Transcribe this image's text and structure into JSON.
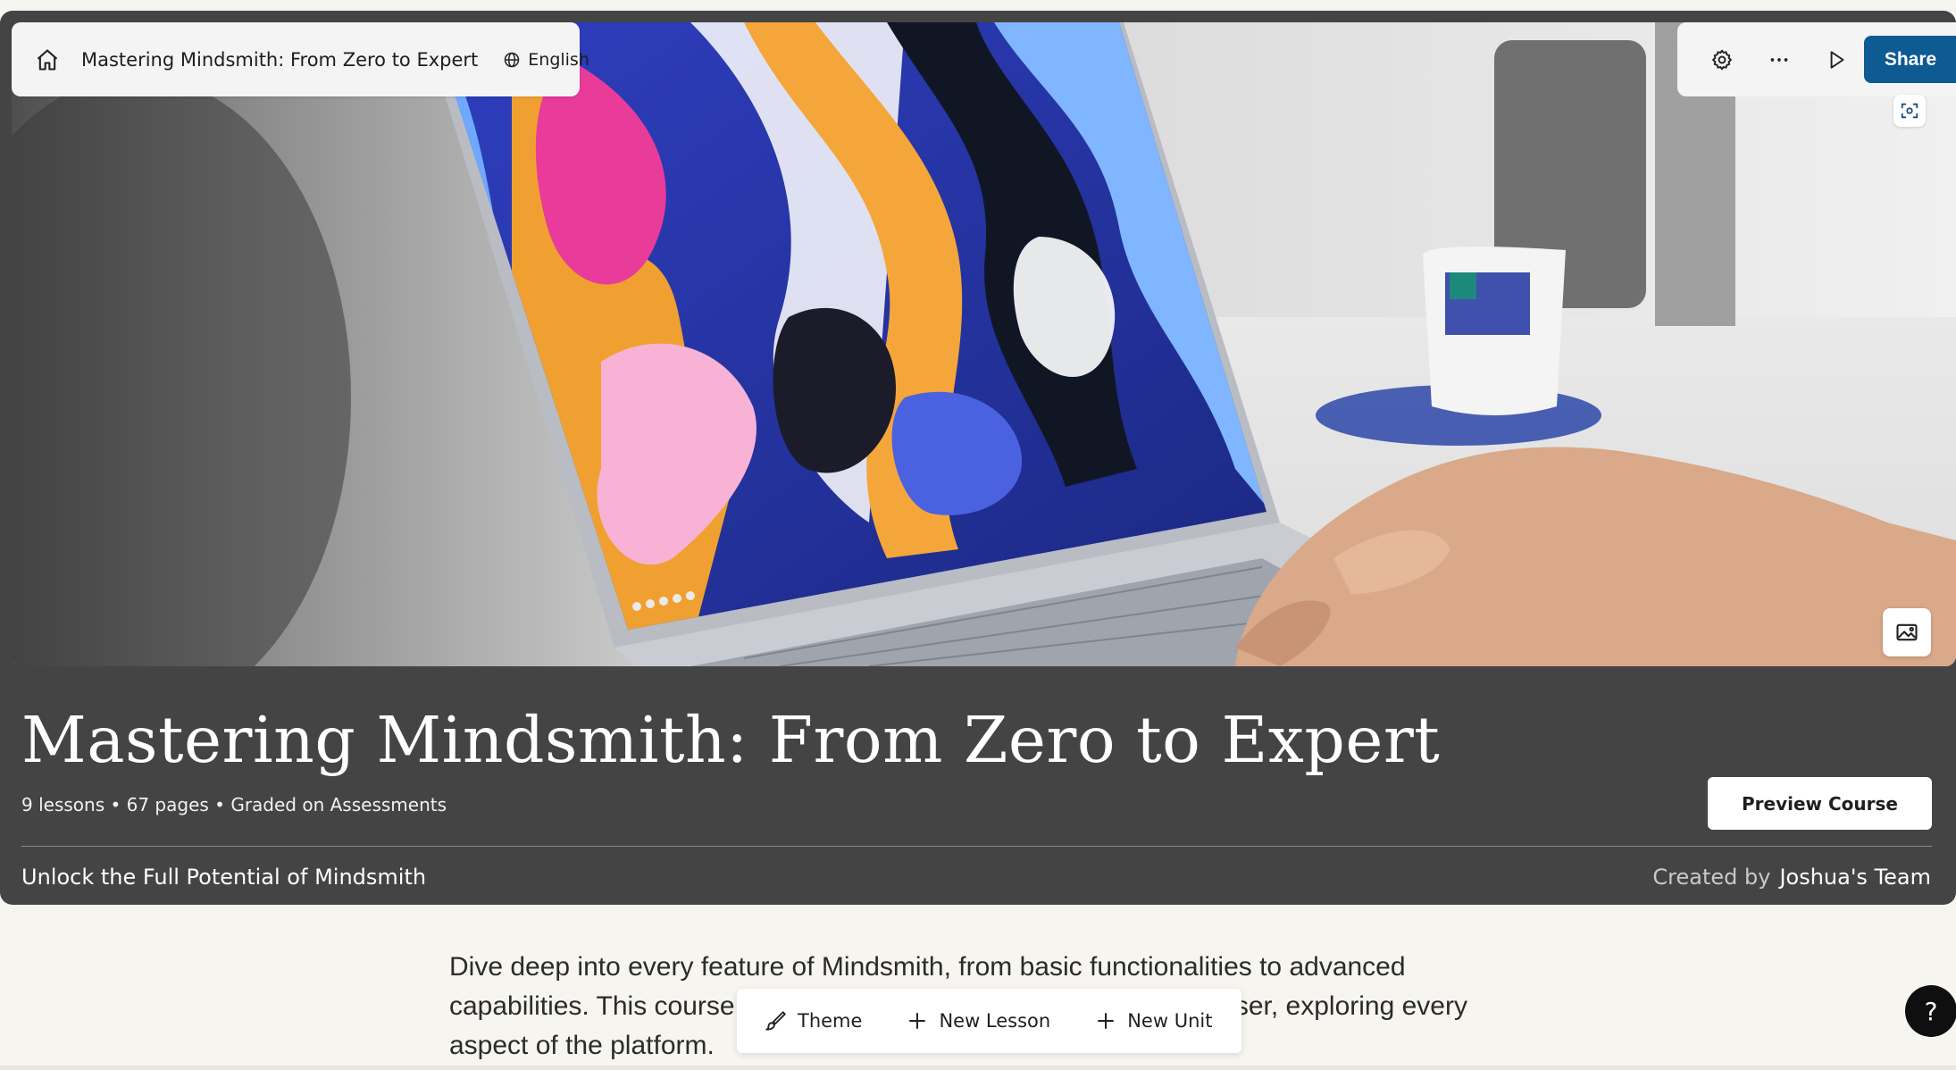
{
  "header": {
    "course_title": "Mastering Mindsmith: From Zero to Expert",
    "language": "English",
    "icons": {
      "home": "home-icon",
      "globe": "globe-icon",
      "settings": "gear-icon",
      "more": "more-horizontal-icon",
      "play": "play-icon"
    },
    "share_label": "Share"
  },
  "hero": {
    "title": "Mastering Mindsmith: From Zero to Expert",
    "meta": "9 lessons • 67 pages • Graded on Assessments",
    "preview_label": "Preview Course",
    "subtitle": "Unlock the Full Potential of Mindsmith",
    "created_by_label": "Created by",
    "team_name": "Joshua's Team"
  },
  "description": "Dive deep into every feature of Mindsmith, from basic functionalities to advanced capabilities. This course will guide you from a novice to a master user, exploring every aspect of the platform.",
  "toolbar": {
    "theme_label": "Theme",
    "new_lesson_label": "New Lesson",
    "new_unit_label": "New Unit"
  },
  "help_label": "?",
  "colors": {
    "accent": "#0e5a92",
    "hero_bg": "#444444",
    "page_bg": "#f7f5f0"
  }
}
